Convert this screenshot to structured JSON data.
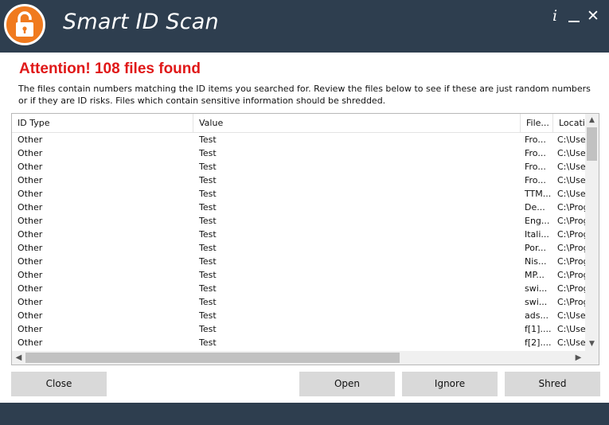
{
  "app": {
    "title": "Smart ID Scan",
    "controls": {
      "info": "i",
      "minimize": "",
      "close": "✕"
    }
  },
  "colors": {
    "titlebar": "#2e3e4f",
    "logo": "#f07a1e",
    "attention": "#e01818"
  },
  "main": {
    "attention": "Attention! 108 files found",
    "description": "The files contain numbers matching the ID items you searched for. Review the files below to see if these are just random numbers or if they are ID risks. Files which contain sensitive information should be shredded."
  },
  "table": {
    "columns": [
      "ID Type",
      "Value",
      "File...",
      "Locatio"
    ],
    "rows": [
      [
        "Other",
        "Test",
        "Fro...",
        "C:\\User"
      ],
      [
        "Other",
        "Test",
        "Fro...",
        "C:\\User"
      ],
      [
        "Other",
        "Test",
        "Fro...",
        "C:\\User"
      ],
      [
        "Other",
        "Test",
        "Fro...",
        "C:\\User"
      ],
      [
        "Other",
        "Test",
        "TTM...",
        "C:\\User"
      ],
      [
        "Other",
        "Test",
        "De...",
        "C:\\Prog"
      ],
      [
        "Other",
        "Test",
        "Eng...",
        "C:\\Prog"
      ],
      [
        "Other",
        "Test",
        "Itali...",
        "C:\\Prog"
      ],
      [
        "Other",
        "Test",
        "Por...",
        "C:\\Prog"
      ],
      [
        "Other",
        "Test",
        "Nis...",
        "C:\\Prog"
      ],
      [
        "Other",
        "Test",
        "MP...",
        "C:\\Prog"
      ],
      [
        "Other",
        "Test",
        "swi...",
        "C:\\Prog"
      ],
      [
        "Other",
        "Test",
        "swi...",
        "C:\\Prog"
      ],
      [
        "Other",
        "Test",
        "ads...",
        "C:\\User"
      ],
      [
        "Other",
        "Test",
        "f[1]....",
        "C:\\User"
      ],
      [
        "Other",
        "Test",
        "f[2]....",
        "C:\\User"
      ]
    ]
  },
  "buttons": {
    "close": "Close",
    "open": "Open",
    "ignore": "Ignore",
    "shred": "Shred"
  }
}
